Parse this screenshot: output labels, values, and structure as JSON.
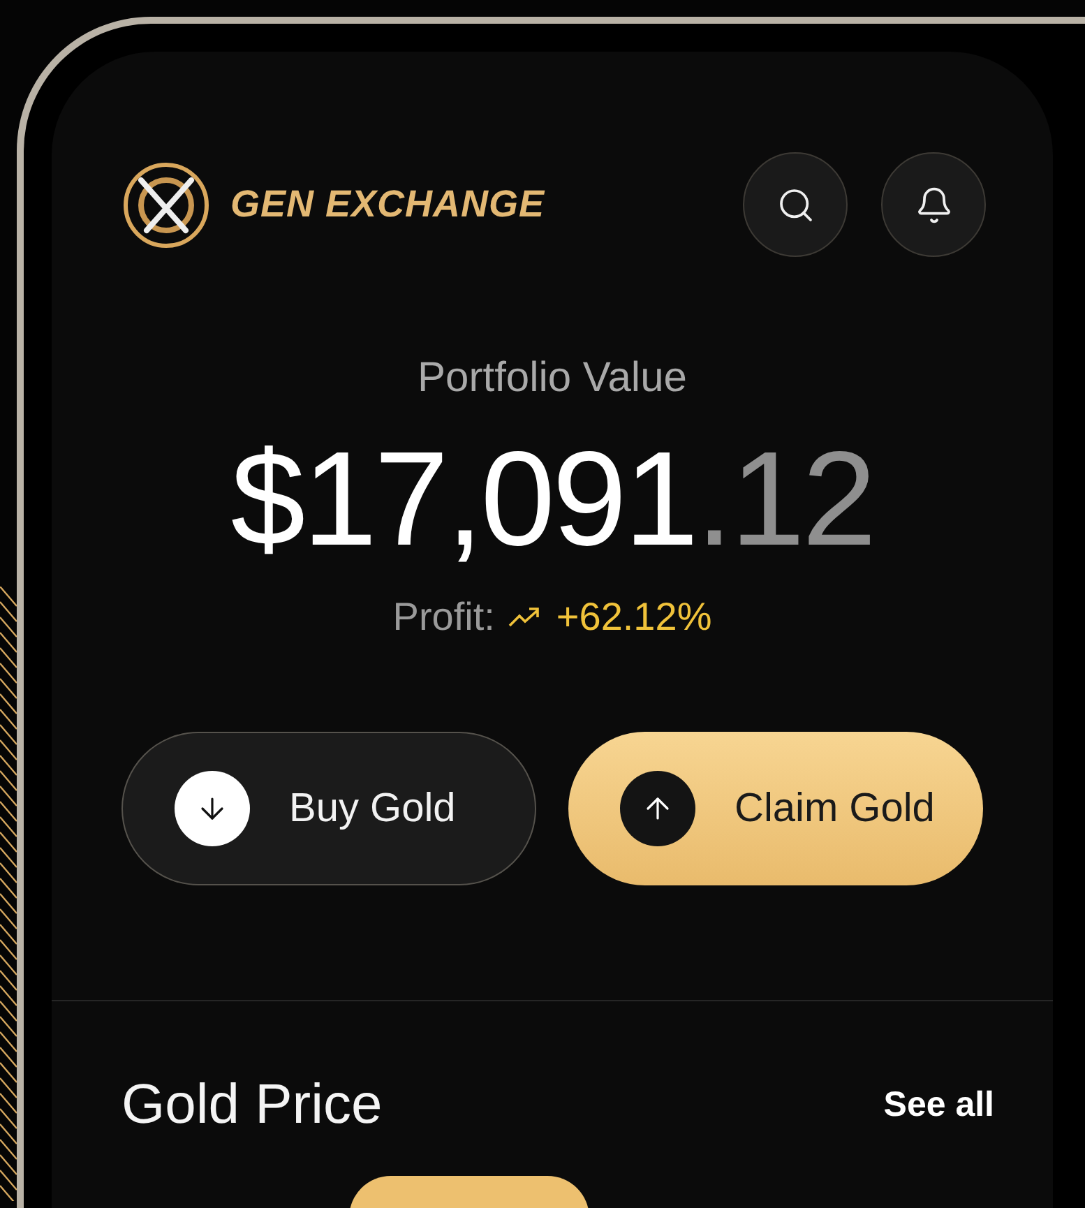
{
  "header": {
    "brand": "GEN EXCHANGE",
    "actions": [
      {
        "kind": "search"
      },
      {
        "kind": "bell"
      }
    ]
  },
  "portfolio": {
    "label": "Portfolio Value",
    "amount_whole": "$17,091",
    "amount_fraction": ".12",
    "profit_label": "Profit:",
    "profit_rising": true,
    "profit_value": "+62.12%"
  },
  "actions": [
    {
      "label": "Buy Gold",
      "kind": "buy"
    },
    {
      "label": "Claim Gold",
      "kind": "claim"
    }
  ],
  "section": {
    "title": "Gold Price",
    "link": "See all"
  }
}
